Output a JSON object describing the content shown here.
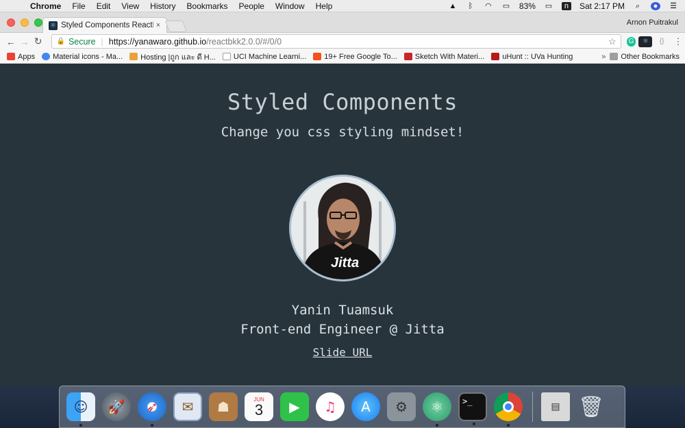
{
  "menubar": {
    "app": "Chrome",
    "menus": [
      "File",
      "Edit",
      "View",
      "History",
      "Bookmarks",
      "People",
      "Window",
      "Help"
    ],
    "battery": "83%",
    "clock": "Sat 2:17 PM"
  },
  "tab": {
    "title": "Styled Components ReactBKK",
    "close": "×"
  },
  "profile_name": "Arnon Puitrakul",
  "omnibox": {
    "secure_label": "Secure",
    "sep": "|",
    "host": "https://yanawaro.github.io",
    "path": "/reactbkk2.0.0/#/0/0"
  },
  "bookmarks": [
    {
      "label": "Apps",
      "color": "#e94335"
    },
    {
      "label": "Material icons - Ma...",
      "color": "#4285f4"
    },
    {
      "label": "Hosting |ถูก และ ดี H...",
      "color": "#e9a23b"
    },
    {
      "label": "UCI Machine Learni...",
      "color": "#9aa0a6"
    },
    {
      "label": "19+ Free Google To...",
      "color": "#f4511e"
    },
    {
      "label": "Sketch With Materi...",
      "color": "#c62828"
    },
    {
      "label": "uHunt :: UVa Hunting",
      "color": "#b71c1c"
    }
  ],
  "bookmarks_overflow": "»",
  "other_bookmarks": "Other Bookmarks",
  "slide": {
    "title": "Styled Components",
    "subtitle": "Change you css styling mindset!",
    "name": "Yanin Tuamsuk",
    "role": "Front-end Engineer @ Jitta",
    "link": "Slide URL",
    "shirt_text": "Jitta"
  },
  "dock": {
    "calendar_month": "JUN",
    "calendar_day": "3"
  }
}
